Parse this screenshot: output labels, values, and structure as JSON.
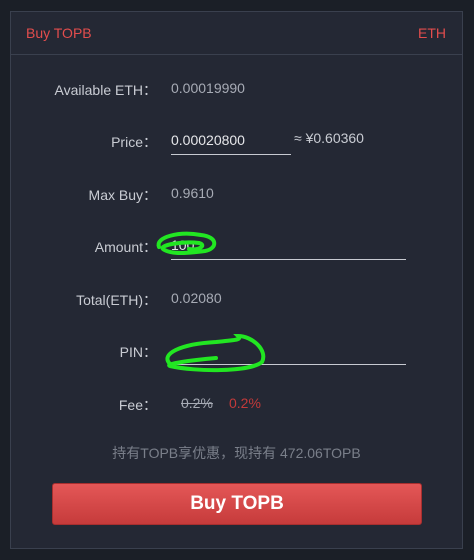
{
  "header": {
    "title": "Buy TOPB",
    "currency": "ETH"
  },
  "form": {
    "available": {
      "label": "Available ETH：",
      "value": "0.00019990"
    },
    "price": {
      "label": "Price：",
      "value": "0.00020800",
      "approx": "≈ ¥0.60360"
    },
    "max_buy": {
      "label": "Max Buy：",
      "value": "0.9610"
    },
    "amount": {
      "label": "Amount：",
      "value": "100"
    },
    "total": {
      "label": "Total(ETH)：",
      "value": "0.02080"
    },
    "pin": {
      "label": "PIN：",
      "value": ""
    },
    "fee": {
      "label": "Fee：",
      "old": "0.2%",
      "new": "0.2%"
    }
  },
  "promo_text": "持有TOPB享优惠，现持有 472.06TOPB",
  "buy_button": "Buy TOPB",
  "colors": {
    "accent": "#e24d4d",
    "button": "#d64545",
    "background": "#242834",
    "annotation": "#22e622"
  }
}
